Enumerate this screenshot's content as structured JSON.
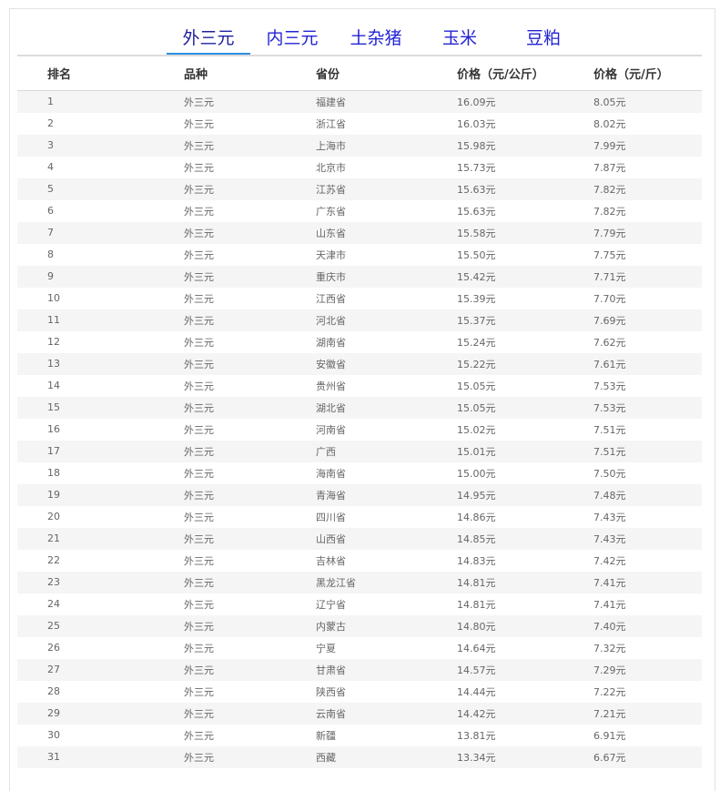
{
  "tabs": [
    {
      "label": "外三元",
      "active": true
    },
    {
      "label": "内三元",
      "active": false
    },
    {
      "label": "土杂猪",
      "active": false
    },
    {
      "label": "玉米",
      "active": false
    },
    {
      "label": "豆粕",
      "active": false
    }
  ],
  "table": {
    "headers": [
      "排名",
      "品种",
      "省份",
      "价格（元/公斤）",
      "价格（元/斤）"
    ],
    "rows": [
      [
        "1",
        "外三元",
        "福建省",
        "16.09元",
        "8.05元"
      ],
      [
        "2",
        "外三元",
        "浙江省",
        "16.03元",
        "8.02元"
      ],
      [
        "3",
        "外三元",
        "上海市",
        "15.98元",
        "7.99元"
      ],
      [
        "4",
        "外三元",
        "北京市",
        "15.73元",
        "7.87元"
      ],
      [
        "5",
        "外三元",
        "江苏省",
        "15.63元",
        "7.82元"
      ],
      [
        "6",
        "外三元",
        "广东省",
        "15.63元",
        "7.82元"
      ],
      [
        "7",
        "外三元",
        "山东省",
        "15.58元",
        "7.79元"
      ],
      [
        "8",
        "外三元",
        "天津市",
        "15.50元",
        "7.75元"
      ],
      [
        "9",
        "外三元",
        "重庆市",
        "15.42元",
        "7.71元"
      ],
      [
        "10",
        "外三元",
        "江西省",
        "15.39元",
        "7.70元"
      ],
      [
        "11",
        "外三元",
        "河北省",
        "15.37元",
        "7.69元"
      ],
      [
        "12",
        "外三元",
        "湖南省",
        "15.24元",
        "7.62元"
      ],
      [
        "13",
        "外三元",
        "安徽省",
        "15.22元",
        "7.61元"
      ],
      [
        "14",
        "外三元",
        "贵州省",
        "15.05元",
        "7.53元"
      ],
      [
        "15",
        "外三元",
        "湖北省",
        "15.05元",
        "7.53元"
      ],
      [
        "16",
        "外三元",
        "河南省",
        "15.02元",
        "7.51元"
      ],
      [
        "17",
        "外三元",
        "广西",
        "15.01元",
        "7.51元"
      ],
      [
        "18",
        "外三元",
        "海南省",
        "15.00元",
        "7.50元"
      ],
      [
        "19",
        "外三元",
        "青海省",
        "14.95元",
        "7.48元"
      ],
      [
        "20",
        "外三元",
        "四川省",
        "14.86元",
        "7.43元"
      ],
      [
        "21",
        "外三元",
        "山西省",
        "14.85元",
        "7.43元"
      ],
      [
        "22",
        "外三元",
        "吉林省",
        "14.83元",
        "7.42元"
      ],
      [
        "23",
        "外三元",
        "黑龙江省",
        "14.81元",
        "7.41元"
      ],
      [
        "24",
        "外三元",
        "辽宁省",
        "14.81元",
        "7.41元"
      ],
      [
        "25",
        "外三元",
        "内蒙古",
        "14.80元",
        "7.40元"
      ],
      [
        "26",
        "外三元",
        "宁夏",
        "14.64元",
        "7.32元"
      ],
      [
        "27",
        "外三元",
        "甘肃省",
        "14.57元",
        "7.29元"
      ],
      [
        "28",
        "外三元",
        "陕西省",
        "14.44元",
        "7.22元"
      ],
      [
        "29",
        "外三元",
        "云南省",
        "14.42元",
        "7.21元"
      ],
      [
        "30",
        "外三元",
        "新疆",
        "13.81元",
        "6.91元"
      ],
      [
        "31",
        "外三元",
        "西藏",
        "13.34元",
        "6.67元"
      ]
    ]
  },
  "colors": {
    "tab_text": "#2323d4",
    "tab_active_underline": "#2c8fe6",
    "row_stripe": "#f5f5f5"
  }
}
